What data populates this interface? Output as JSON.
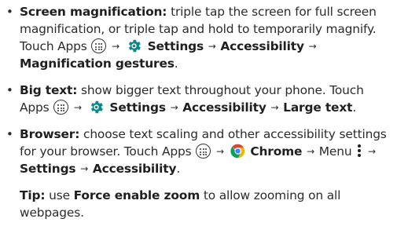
{
  "items": [
    {
      "title": "Screen magnification:",
      "lines": [
        "triple tap the screen for full screen",
        "magnification, or triple tap and hold to temporarily magnify.",
        "Touch Apps",
        "Settings",
        "Accessibility",
        "Magnification gestures"
      ]
    },
    {
      "title": "Big text:",
      "lines": [
        "show bigger text throughout your phone. Touch",
        "Apps",
        "Settings",
        "Accessibility",
        "Large text"
      ]
    },
    {
      "title": "Browser:",
      "lines": [
        "choose text scaling and other accessibility settings",
        "for your browser. Touch Apps",
        "Chrome",
        "Menu",
        "Settings",
        "Accessibility"
      ]
    }
  ],
  "tip": {
    "label": "Tip:",
    "text_before": "use",
    "emphasis": "Force enable zoom",
    "text_after": "to allow zooming on all",
    "line2": "webpages."
  },
  "icons": [
    "apps-icon",
    "settings-gear-icon",
    "chrome-icon",
    "menu-dots-icon",
    "arrow-icon"
  ],
  "colors": {
    "text": "#2b2b2b",
    "settings_gear": "#0a8a8a",
    "chrome_red": "#db4437",
    "chrome_yellow": "#f4b400",
    "chrome_green": "#0f9d58",
    "chrome_blue": "#4285f4"
  }
}
